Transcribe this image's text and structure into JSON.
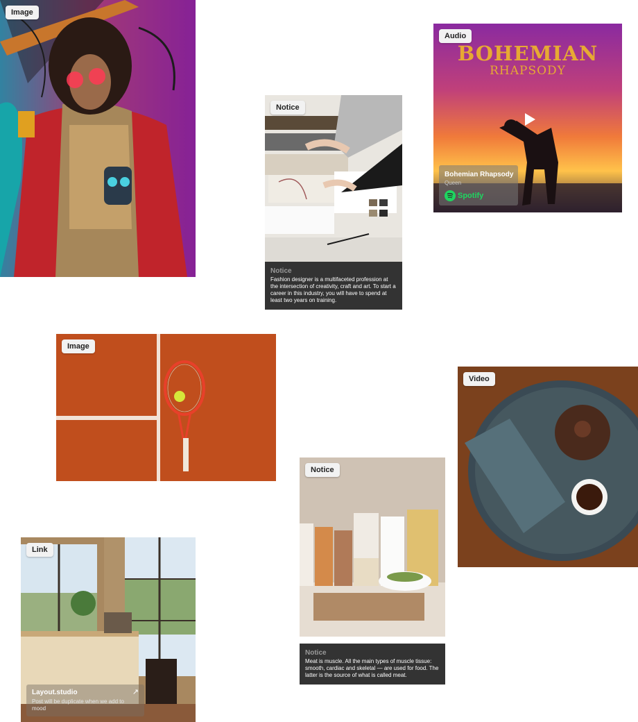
{
  "cards": {
    "musician": {
      "badge": "Image"
    },
    "fashion": {
      "badge": "Notice",
      "notice_title": "Notice",
      "notice_text": "Fashion designer is a multifaceted profession at the intersection of creativity, craft and art. To start a career in this industry, you will have to spend at least two years on training."
    },
    "audio": {
      "badge": "Audio",
      "poster_title": "BOHEMIAN",
      "poster_subtitle": "RHAPSODY",
      "track_title": "Bohemian Rhapsody",
      "artist": "Queen",
      "service": "Spotify"
    },
    "tennis": {
      "badge": "Image"
    },
    "tea": {
      "badge": "Video"
    },
    "pantry": {
      "badge": "Notice",
      "notice_title": "Notice",
      "notice_text": "Meat is muscle. All the main types of muscle tissue: smooth, cardiac and skeletal — are used for food. The latter is the source of what is called meat."
    },
    "room": {
      "badge": "Link",
      "link_title": "Layout.studio",
      "link_subtitle": "Post will be duplicate when we  add to mood"
    }
  },
  "colors": {
    "notice_bg": "#333333",
    "spotify_green": "#1ed760",
    "poster_gold": "#e7a933"
  }
}
